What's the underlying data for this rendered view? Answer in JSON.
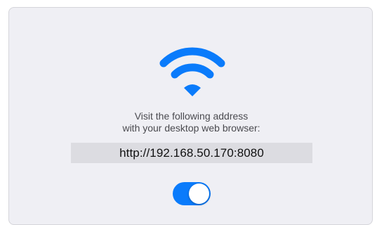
{
  "icons": {
    "wifi": "wifi-icon"
  },
  "colors": {
    "accent": "#0a7bfb",
    "panel_background": "#efeff4",
    "address_background": "#dcdce1"
  },
  "instructions": {
    "line1": "Visit the following address",
    "line2": "with your desktop web browser:"
  },
  "server": {
    "address": "http://192.168.50.170:8080"
  },
  "toggle": {
    "state": "on"
  }
}
